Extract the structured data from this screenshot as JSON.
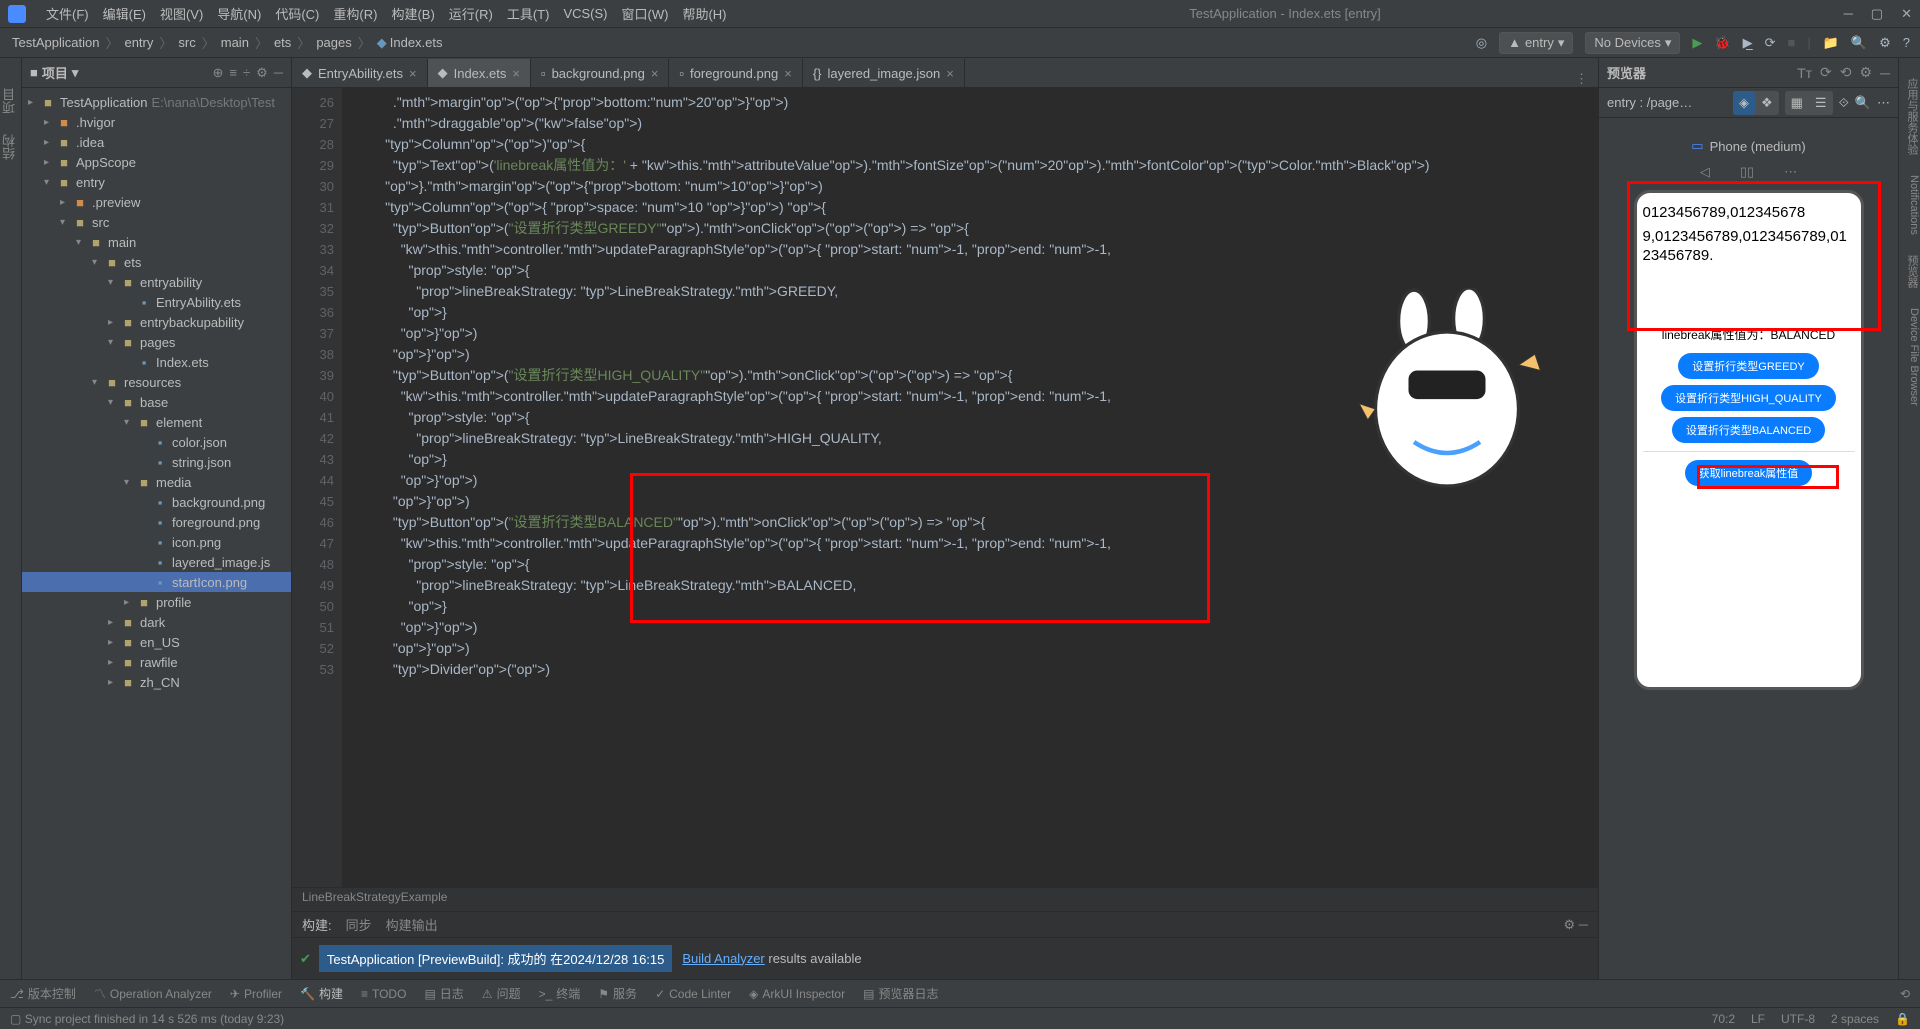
{
  "menu": {
    "items": [
      "文件(F)",
      "编辑(E)",
      "视图(V)",
      "导航(N)",
      "代码(C)",
      "重构(R)",
      "构建(B)",
      "运行(R)",
      "工具(T)",
      "VCS(S)",
      "窗口(W)",
      "帮助(H)"
    ],
    "title": "TestApplication - Index.ets [entry]"
  },
  "crumbs": [
    "TestApplication",
    "entry",
    "src",
    "main",
    "ets",
    "pages",
    "Index.ets"
  ],
  "runconfig": {
    "module": "entry",
    "device": "No Devices"
  },
  "project": {
    "head": "项目",
    "tree": [
      {
        "d": 0,
        "t": ">",
        "ic": "folder",
        "nm": "TestApplication",
        "pth": "E:\\nana\\Desktop\\Test"
      },
      {
        "d": 1,
        "t": ">",
        "ic": "folderh",
        "nm": ".hvigor"
      },
      {
        "d": 1,
        "t": ">",
        "ic": "folder",
        "nm": ".idea"
      },
      {
        "d": 1,
        "t": ">",
        "ic": "folder",
        "nm": "AppScope"
      },
      {
        "d": 1,
        "t": "v",
        "ic": "folder",
        "nm": "entry"
      },
      {
        "d": 2,
        "t": ">",
        "ic": "folderh",
        "nm": ".preview"
      },
      {
        "d": 2,
        "t": "v",
        "ic": "folder",
        "nm": "src"
      },
      {
        "d": 3,
        "t": "v",
        "ic": "folder",
        "nm": "main"
      },
      {
        "d": 4,
        "t": "v",
        "ic": "folder",
        "nm": "ets"
      },
      {
        "d": 5,
        "t": "v",
        "ic": "folder",
        "nm": "entryability"
      },
      {
        "d": 6,
        "t": "",
        "ic": "file",
        "nm": "EntryAbility.ets"
      },
      {
        "d": 5,
        "t": ">",
        "ic": "folder",
        "nm": "entrybackupability"
      },
      {
        "d": 5,
        "t": "v",
        "ic": "folder",
        "nm": "pages"
      },
      {
        "d": 6,
        "t": "",
        "ic": "file",
        "nm": "Index.ets"
      },
      {
        "d": 4,
        "t": "v",
        "ic": "folder",
        "nm": "resources"
      },
      {
        "d": 5,
        "t": "v",
        "ic": "folder",
        "nm": "base"
      },
      {
        "d": 6,
        "t": "v",
        "ic": "folder",
        "nm": "element"
      },
      {
        "d": 7,
        "t": "",
        "ic": "file",
        "nm": "color.json"
      },
      {
        "d": 7,
        "t": "",
        "ic": "file",
        "nm": "string.json"
      },
      {
        "d": 6,
        "t": "v",
        "ic": "folder",
        "nm": "media"
      },
      {
        "d": 7,
        "t": "",
        "ic": "file",
        "nm": "background.png"
      },
      {
        "d": 7,
        "t": "",
        "ic": "file",
        "nm": "foreground.png"
      },
      {
        "d": 7,
        "t": "",
        "ic": "file",
        "nm": "icon.png"
      },
      {
        "d": 7,
        "t": "",
        "ic": "file",
        "nm": "layered_image.js"
      },
      {
        "d": 7,
        "t": "",
        "ic": "file",
        "nm": "startIcon.png",
        "sel": true
      },
      {
        "d": 6,
        "t": ">",
        "ic": "folder",
        "nm": "profile"
      },
      {
        "d": 5,
        "t": ">",
        "ic": "folder",
        "nm": "dark"
      },
      {
        "d": 5,
        "t": ">",
        "ic": "folder",
        "nm": "en_US"
      },
      {
        "d": 5,
        "t": ">",
        "ic": "folder",
        "nm": "rawfile"
      },
      {
        "d": 5,
        "t": ">",
        "ic": "folder",
        "nm": "zh_CN"
      }
    ]
  },
  "tabs": [
    {
      "nm": "EntryAbility.ets"
    },
    {
      "nm": "Index.ets",
      "act": true
    },
    {
      "nm": "background.png"
    },
    {
      "nm": "foreground.png"
    },
    {
      "nm": "layered_image.json"
    }
  ],
  "code": {
    "start": 26,
    "lines": [
      "          .margin({bottom:20})",
      "          .draggable(false)",
      "        Column(){",
      "          Text('linebreak属性值为：' + this.attributeValue).fontSize(20).fontColor(Color.Black)",
      "        }.margin({bottom: 10})",
      "        Column({ space: 10 }) {",
      "          Button(\"设置折行类型GREEDY\").onClick(() => {",
      "            this.controller.updateParagraphStyle({ start: -1, end: -1,",
      "              style: {",
      "                lineBreakStrategy: LineBreakStrategy.GREEDY,",
      "              }",
      "            })",
      "          })",
      "          Button(\"设置折行类型HIGH_QUALITY\").onClick(() => {",
      "            this.controller.updateParagraphStyle({ start: -1, end: -1,",
      "              style: {",
      "                lineBreakStrategy: LineBreakStrategy.HIGH_QUALITY,",
      "              }",
      "            })",
      "          })",
      "          Button(\"设置折行类型BALANCED\").onClick(() => {",
      "            this.controller.updateParagraphStyle({ start: -1, end: -1,",
      "              style: {",
      "                lineBreakStrategy: LineBreakStrategy.BALANCED,",
      "              }",
      "            })",
      "          })",
      "          Divider()"
    ],
    "crumb": "LineBreakStrategyExample"
  },
  "preview": {
    "head": "预览器",
    "page": "entry : /page…",
    "device": "Phone (medium)",
    "phone": {
      "text1": "0123456789,012345678",
      "text2": "9,0123456789,0123456789,0123456789.",
      "attr": "linebreak属性值为：BALANCED",
      "btns": [
        "设置折行类型GREEDY",
        "设置折行类型HIGH_QUALITY",
        "设置折行类型BALANCED",
        "获取linebreak属性值"
      ]
    }
  },
  "build": {
    "tabs": [
      "构建:",
      "同步",
      "构建输出"
    ],
    "msg": "TestApplication [PreviewBuild]: 成功的 在2024/12/28 16:15",
    "analyzer": "Build Analyzer",
    "result": " results available"
  },
  "bottom": [
    "版本控制",
    "Operation Analyzer",
    "Profiler",
    "构建",
    "TODO",
    "日志",
    "问题",
    "终端",
    "服务",
    "Code Linter",
    "ArkUI Inspector",
    "预览器日志"
  ],
  "status": {
    "msg": "Sync project finished in 14 s 526 ms (today 9:23)",
    "right": [
      "70:2",
      "LF",
      "UTF-8",
      "2 spaces"
    ]
  },
  "leftstrip": [
    "项目",
    "结构"
  ],
  "rightstrip": [
    "应用与服务体验",
    "Notifications",
    "预览器",
    "Device File Browser"
  ]
}
